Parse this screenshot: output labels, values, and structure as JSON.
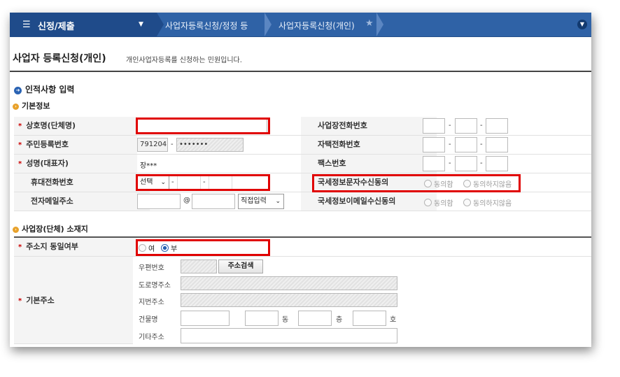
{
  "nav": {
    "menu_label": "신정/제출",
    "crumbs": [
      "사업자등록신청/정정 등",
      "사업자등록신청(개인)"
    ]
  },
  "page": {
    "title": "사업자 등록신청(개인)",
    "description": "개인사업자등록를 신청하는 민원입니다."
  },
  "sections": {
    "personal": "인적사항 입력",
    "basic": "기본정보",
    "location": "사업장(단체) 소재지"
  },
  "fields": {
    "company_name": "상호명(단체명)",
    "rrn": "주민등록번호",
    "rrn_front": "791204",
    "rrn_back": "•••••••",
    "rep_name": "성명(대표자)",
    "rep_value": "장***",
    "mobile": "휴대전화번호",
    "mobile_select": "선택",
    "email": "전자메일주소",
    "email_at": "@",
    "email_select": "직접입력",
    "biz_phone": "사업장전화번호",
    "home_phone": "자택전화번호",
    "fax": "팩스번호",
    "sms_consent": "국세정보문자수신동의",
    "email_consent": "국세정보이메일수신동의",
    "agree": "동의함",
    "disagree": "동의하지않음",
    "dash": "-"
  },
  "address": {
    "same_label": "주소지 동일여부",
    "yes": "여",
    "no": "부",
    "basic_label": "기본주소",
    "zip": "우편번호",
    "search_btn": "주소검색",
    "road": "도로명주소",
    "lot": "지번주소",
    "building": "건물명",
    "dong": "동",
    "floor": "층",
    "ho": "호",
    "other": "기타주소"
  }
}
